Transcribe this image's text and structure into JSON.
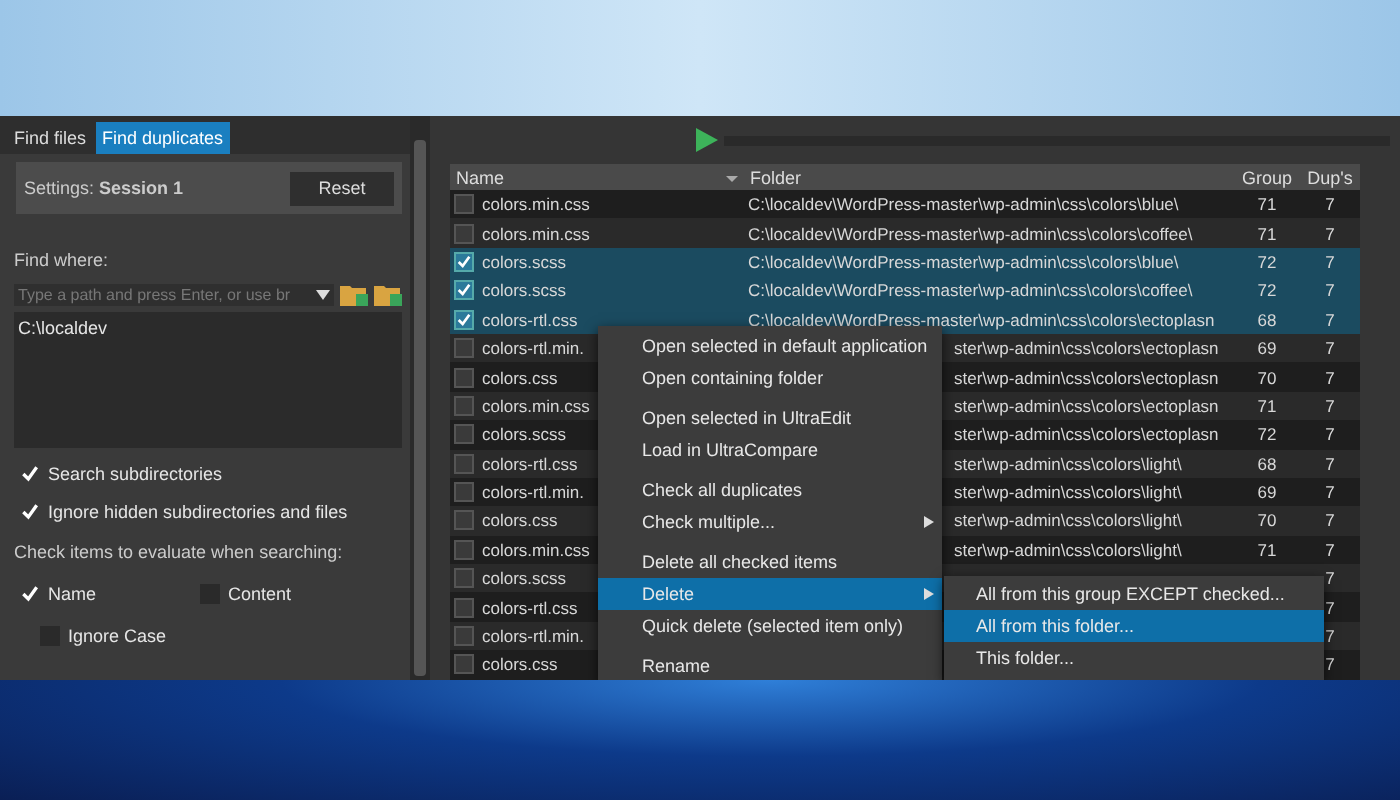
{
  "progress": {
    "level": 0
  },
  "tabs": [
    {
      "label": "Find files",
      "selected": false
    },
    {
      "label": "Find duplicates",
      "selected": true
    }
  ],
  "settings": {
    "label": "Settings: **Session 1**",
    "reset_button": "Reset"
  },
  "find_where": {
    "label": "Find where:",
    "placeholder": "Type a path and press Enter, or use br",
    "paths": [
      "C:\\localdev"
    ]
  },
  "options": [
    {
      "label": "Search subdirectories",
      "checked": true
    },
    {
      "label": "Ignore hidden subdirectories and files",
      "checked": true
    }
  ],
  "evaluate": {
    "label": "Check items to evaluate when searching:",
    "items": [
      {
        "label": "Name",
        "checked": true
      },
      {
        "label": "Content",
        "checked": false
      }
    ],
    "ignore_case": {
      "label": "Ignore Case",
      "checked": false
    }
  },
  "table": {
    "columns": [
      "Name",
      "Folder",
      "Group",
      "Dup's"
    ],
    "rows": [
      {
        "kind": "full",
        "name": "colors.min.css",
        "folder": "C:\\localdev\\WordPress-master\\wp-admin\\css\\colors\\blue\\",
        "group": "71",
        "dups": "7",
        "checked": false,
        "selected": false
      },
      {
        "kind": "full",
        "name": "colors.min.css",
        "folder": "C:\\localdev\\WordPress-master\\wp-admin\\css\\colors\\coffee\\",
        "group": "71",
        "dups": "7",
        "checked": false,
        "selected": false
      },
      {
        "kind": "full",
        "name": "colors.scss",
        "folder": "C:\\localdev\\WordPress-master\\wp-admin\\css\\colors\\blue\\",
        "group": "72",
        "dups": "7",
        "checked": true,
        "selected": true
      },
      {
        "kind": "full",
        "name": "colors.scss",
        "folder": "C:\\localdev\\WordPress-master\\wp-admin\\css\\colors\\coffee\\",
        "group": "72",
        "dups": "7",
        "checked": true,
        "selected": true
      },
      {
        "kind": "full",
        "name": "colors-rtl.css",
        "folder": "C:\\localdev\\WordPress-master\\wp-admin\\css\\colors\\ectoplasn",
        "group": "68",
        "dups": "7",
        "checked": true,
        "selected": true
      },
      {
        "kind": "under_menu",
        "name": "colors-rtl.min.",
        "folder": "ster\\wp-admin\\css\\colors\\ectoplasn",
        "group": "69",
        "dups": "7",
        "checked": false,
        "selected": false
      },
      {
        "kind": "under_menu",
        "name": "colors.css",
        "folder": "ster\\wp-admin\\css\\colors\\ectoplasn",
        "group": "70",
        "dups": "7",
        "checked": false,
        "selected": false
      },
      {
        "kind": "under_menu",
        "name": "colors.min.css",
        "folder": "ster\\wp-admin\\css\\colors\\ectoplasn",
        "group": "71",
        "dups": "7",
        "checked": false,
        "selected": false
      },
      {
        "kind": "under_menu",
        "name": "colors.scss",
        "folder": "ster\\wp-admin\\css\\colors\\ectoplasn",
        "group": "72",
        "dups": "7",
        "checked": false,
        "selected": false
      },
      {
        "kind": "under_menu",
        "name": "colors-rtl.css",
        "folder": "ster\\wp-admin\\css\\colors\\light\\",
        "group": "68",
        "dups": "7",
        "checked": false,
        "selected": false
      },
      {
        "kind": "under_menu",
        "name": "colors-rtl.min.",
        "folder": "ster\\wp-admin\\css\\colors\\light\\",
        "group": "69",
        "dups": "7",
        "checked": false,
        "selected": false
      },
      {
        "kind": "under_menu",
        "name": "colors.css",
        "folder": "ster\\wp-admin\\css\\colors\\light\\",
        "group": "70",
        "dups": "7",
        "checked": false,
        "selected": false
      },
      {
        "kind": "under_menu",
        "name": "colors.min.css",
        "folder": "ster\\wp-admin\\css\\colors\\light\\",
        "group": "71",
        "dups": "7",
        "checked": false,
        "selected": false
      },
      {
        "kind": "under_submenu",
        "name": "colors.scss",
        "dups": "7",
        "checked": false,
        "selected": false
      },
      {
        "kind": "under_submenu",
        "name": "colors-rtl.css",
        "dups": "7",
        "checked": false,
        "selected": false
      },
      {
        "kind": "under_submenu",
        "name": "colors-rtl.min.",
        "dups": "7",
        "checked": false,
        "selected": false
      },
      {
        "kind": "under_submenu",
        "name": "colors.css",
        "dups": "7",
        "checked": false,
        "selected": false
      }
    ]
  },
  "context_menu": {
    "groups": [
      [
        {
          "label": "Open selected in default application",
          "selected": false,
          "submenu": false
        },
        {
          "label": "Open containing folder",
          "selected": false,
          "submenu": false
        }
      ],
      [
        {
          "label": "Open selected in UltraEdit",
          "selected": false,
          "submenu": false
        },
        {
          "label": "Load in UltraCompare",
          "selected": false,
          "submenu": false
        }
      ],
      [
        {
          "label": "Check all duplicates",
          "selected": false,
          "submenu": false
        },
        {
          "label": "Check multiple...",
          "selected": false,
          "submenu": true
        }
      ],
      [
        {
          "label": "Delete all checked items",
          "selected": false,
          "submenu": false
        },
        {
          "label": "Delete",
          "selected": true,
          "submenu": true
        },
        {
          "label": "Quick delete (selected item only)",
          "selected": false,
          "submenu": false
        }
      ],
      [
        {
          "label": "Rename",
          "selected": false,
          "submenu": false
        }
      ]
    ]
  },
  "submenu": {
    "items": [
      {
        "label": "All from this group EXCEPT checked...",
        "selected": false
      },
      {
        "label": "All from this folder...",
        "selected": true
      },
      {
        "label": "This folder...",
        "selected": false
      }
    ]
  }
}
